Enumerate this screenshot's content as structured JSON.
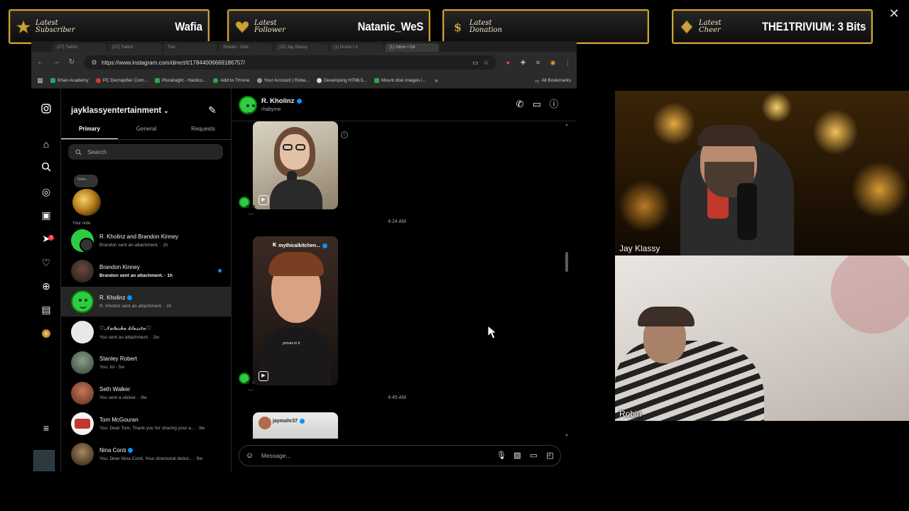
{
  "alerts": [
    {
      "label": "Latest Subscriber",
      "value": "Wafia",
      "icon": "star-badge-icon"
    },
    {
      "label": "Latest Follower",
      "value": "Natanic_WeS",
      "icon": "heart-badge-icon"
    },
    {
      "label": "Latest Donation",
      "value": "",
      "icon": "dollar-badge-icon"
    },
    {
      "label": "Latest Cheer",
      "value": "THE1TRIVIUM: 3 Bits",
      "icon": "diamond-badge-icon"
    }
  ],
  "browser": {
    "tabs": [
      "(27) Twitch",
      "(27) Twitch",
      "Tick",
      "Stream · Kick",
      "(23) Jay Klassy",
      "(1) Home / X",
      "(1) Inbox • Dir"
    ],
    "url": "https://www.instagram.com/direct/t/17844006669186757/",
    "bookmarks": [
      "Khan Academy",
      "PC Decrapifier Com...",
      "Pluralsight - Hardco...",
      "Add to Throne",
      "Your Account | Robe...",
      "Developing HTML5...",
      "Mount disk images i..."
    ],
    "all_bookmarks": "All Bookmarks"
  },
  "instagram": {
    "account": "jayklassyentertainment",
    "tabs": [
      "Primary",
      "General",
      "Requests"
    ],
    "search_placeholder": "Search",
    "note_bubble": "Note...",
    "note_label": "Your note",
    "rail_notification_count": "1",
    "conversations": [
      {
        "name": "R. Kholinz and Brandon Kinney",
        "preview": "Brandon sent an attachment. · 1h",
        "verified": false,
        "unread": false,
        "selected": false
      },
      {
        "name": "Brandon Kinney",
        "preview": "Brandon sent an attachment. · 1h",
        "verified": false,
        "unread": true,
        "selected": false
      },
      {
        "name": "R. Kholinz",
        "preview": "R. Kholinz sent an attachment. · 1h",
        "verified": true,
        "unread": false,
        "selected": true
      },
      {
        "name": "♡𝒩𝒶𝓉𝒶𝓈𝒽𝒶 𝓀𝓁𝒶𝓈𝓈𝑒𝓃♡",
        "preview": "You sent an attachment. · 2w",
        "verified": false,
        "unread": false,
        "selected": false
      },
      {
        "name": "Stanley Robert",
        "preview": "You: lol · 5w",
        "verified": false,
        "unread": false,
        "selected": false
      },
      {
        "name": "Seth Walker",
        "preview": "You sent a sticker. · 9w",
        "verified": false,
        "unread": false,
        "selected": false
      },
      {
        "name": "Tom McGouran",
        "preview": "You: Dear Tom, Thank you for sharing your a... · 9w",
        "verified": false,
        "unread": false,
        "selected": false
      },
      {
        "name": "Nina Conti",
        "preview": "You: Dear Nina Conti, Your directorial debut... · 9w",
        "verified": true,
        "unread": false,
        "selected": false
      }
    ],
    "chat": {
      "name": "R. Kholinz",
      "username": "rhabyrne",
      "timestamps": [
        "4:24 AM",
        "4:45 AM"
      ],
      "reels": [
        {
          "account": "",
          "caption": ""
        },
        {
          "account": "mythicalkitchen...",
          "caption": "proves in it"
        },
        {
          "account": "jaymohr37",
          "caption": ""
        }
      ],
      "composer_placeholder": "Message..."
    }
  },
  "webcams": [
    {
      "label": "Jay Klassy"
    },
    {
      "label": "Robin"
    }
  ],
  "colors": {
    "gold": "#c9a23a",
    "ig_blue": "#0095f6",
    "ig_red": "#ff3040",
    "ghost_green": "#2ecc40"
  }
}
